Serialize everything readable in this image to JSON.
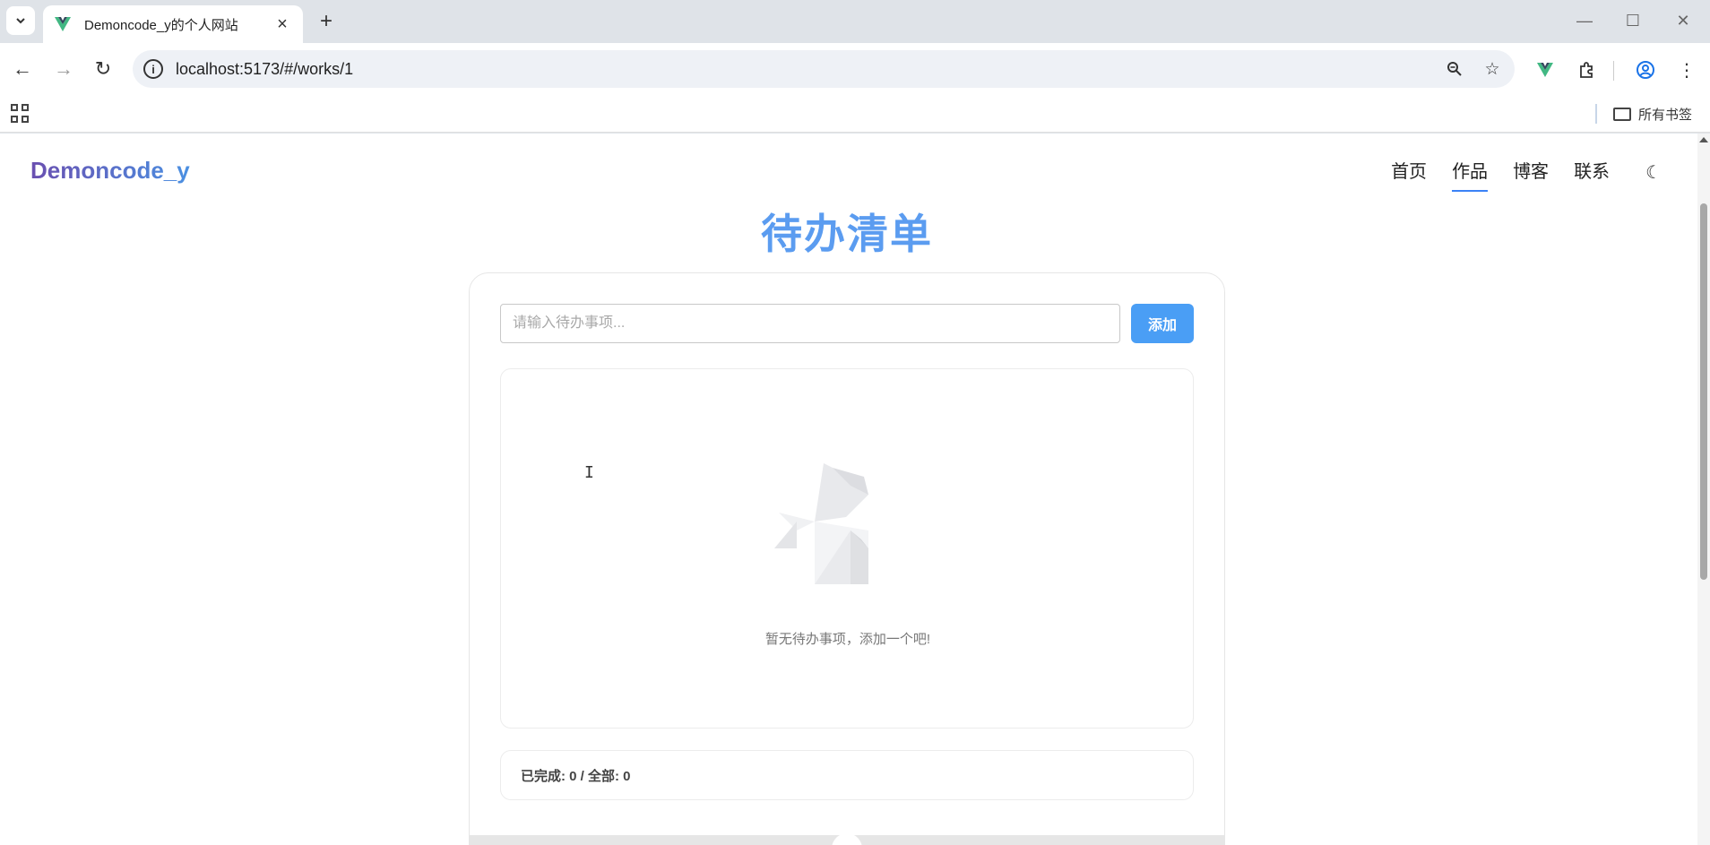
{
  "browser": {
    "tab_title": "Demoncode_y的个人网站",
    "url": "localhost:5173/#/works/1",
    "bookmark_folder": "所有书签"
  },
  "site": {
    "logo": "Demoncode_y",
    "nav": [
      "首页",
      "作品",
      "博客",
      "联系"
    ],
    "active_nav": "作品"
  },
  "todo": {
    "title": "待办清单",
    "input_placeholder": "请输入待办事项...",
    "add_label": "添加",
    "empty_text": "暂无待办事项，添加一个吧!",
    "stats": "已完成: 0 / 全部: 0"
  },
  "colors": {
    "accent": "#4a9ef5",
    "title": "#5b9cf0"
  },
  "icons": {
    "theme": "moon-icon",
    "footer_toggle": "chevron-down-icon"
  }
}
